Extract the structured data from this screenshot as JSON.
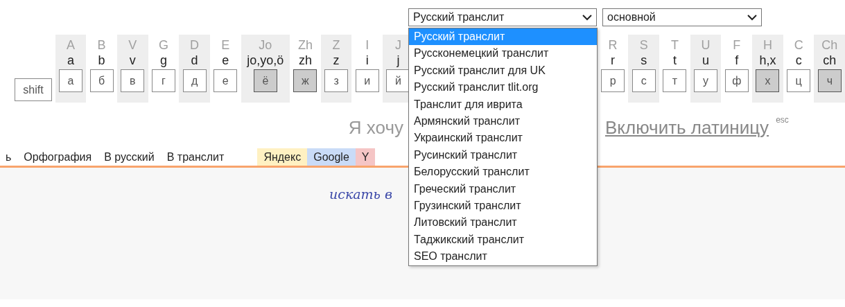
{
  "selects": [
    {
      "value": "Русский транслит",
      "options": [
        {
          "label": "Русский транслит",
          "selected": true
        },
        {
          "label": "Руссконемецкий транслит",
          "selected": false
        },
        {
          "label": "Русский транслит для UK",
          "selected": false
        },
        {
          "label": "Русский транслит tlit.org",
          "selected": false
        },
        {
          "label": "Транслит для иврита",
          "selected": false
        },
        {
          "label": "Армянский транслит",
          "selected": false
        },
        {
          "label": "Украинский транслит",
          "selected": false
        },
        {
          "label": "Русинский транслит",
          "selected": false
        },
        {
          "label": "Белорусский транслит",
          "selected": false
        },
        {
          "label": "Греческий транслит",
          "selected": false
        },
        {
          "label": "Грузинский транслит",
          "selected": false
        },
        {
          "label": "Литовский транслит",
          "selected": false
        },
        {
          "label": "Таджикский транслит",
          "selected": false
        },
        {
          "label": "SEO транслит",
          "selected": false
        }
      ]
    },
    {
      "value": "основной"
    }
  ],
  "keyboard": {
    "shift": "shift",
    "groups": [
      [
        {
          "latin": "A",
          "translit": "a",
          "key": "а",
          "pressed": false
        },
        {
          "latin": "B",
          "translit": "b",
          "key": "б",
          "pressed": false
        },
        {
          "latin": "V",
          "translit": "v",
          "key": "в",
          "pressed": false
        },
        {
          "latin": "G",
          "translit": "g",
          "key": "г",
          "pressed": false
        },
        {
          "latin": "D",
          "translit": "d",
          "key": "д",
          "pressed": false
        },
        {
          "latin": "E",
          "translit": "e",
          "key": "е",
          "pressed": false
        },
        {
          "latin": "Jo",
          "translit": "jo,yo,ö",
          "key": "ё",
          "pressed": true
        },
        {
          "latin": "Zh",
          "translit": "zh",
          "key": "ж",
          "pressed": true
        },
        {
          "latin": "Z",
          "translit": "z",
          "key": "з",
          "pressed": false
        },
        {
          "latin": "I",
          "translit": "i",
          "key": "и",
          "pressed": false
        },
        {
          "latin": "J",
          "translit": "j",
          "key": "й",
          "pressed": false
        }
      ],
      [
        {
          "latin": "R",
          "translit": "r",
          "key": "р",
          "pressed": false
        },
        {
          "latin": "S",
          "translit": "s",
          "key": "с",
          "pressed": false
        },
        {
          "latin": "T",
          "translit": "t",
          "key": "т",
          "pressed": false
        },
        {
          "latin": "U",
          "translit": "u",
          "key": "у",
          "pressed": false
        },
        {
          "latin": "F",
          "translit": "f",
          "key": "ф",
          "pressed": false
        },
        {
          "latin": "H",
          "translit": "h,x",
          "key": "х",
          "pressed": true
        },
        {
          "latin": "C",
          "translit": "c",
          "key": "ц",
          "pressed": false
        },
        {
          "latin": "Ch",
          "translit": "ch",
          "key": "ч",
          "pressed": true
        }
      ]
    ]
  },
  "prompt": "Я хочу",
  "toggle_link": "Включить латиницу",
  "toggle_hint": "esc",
  "menu": [
    "ь",
    "Орфография",
    "В русский",
    "В транслит"
  ],
  "search_tabs": [
    {
      "label": "Яндекс",
      "color": "#fff1c2"
    },
    {
      "label": "Google",
      "color": "#c9dbf7"
    },
    {
      "label": "Y",
      "color": "#f5c5c5"
    }
  ],
  "handwriting": "искать в"
}
